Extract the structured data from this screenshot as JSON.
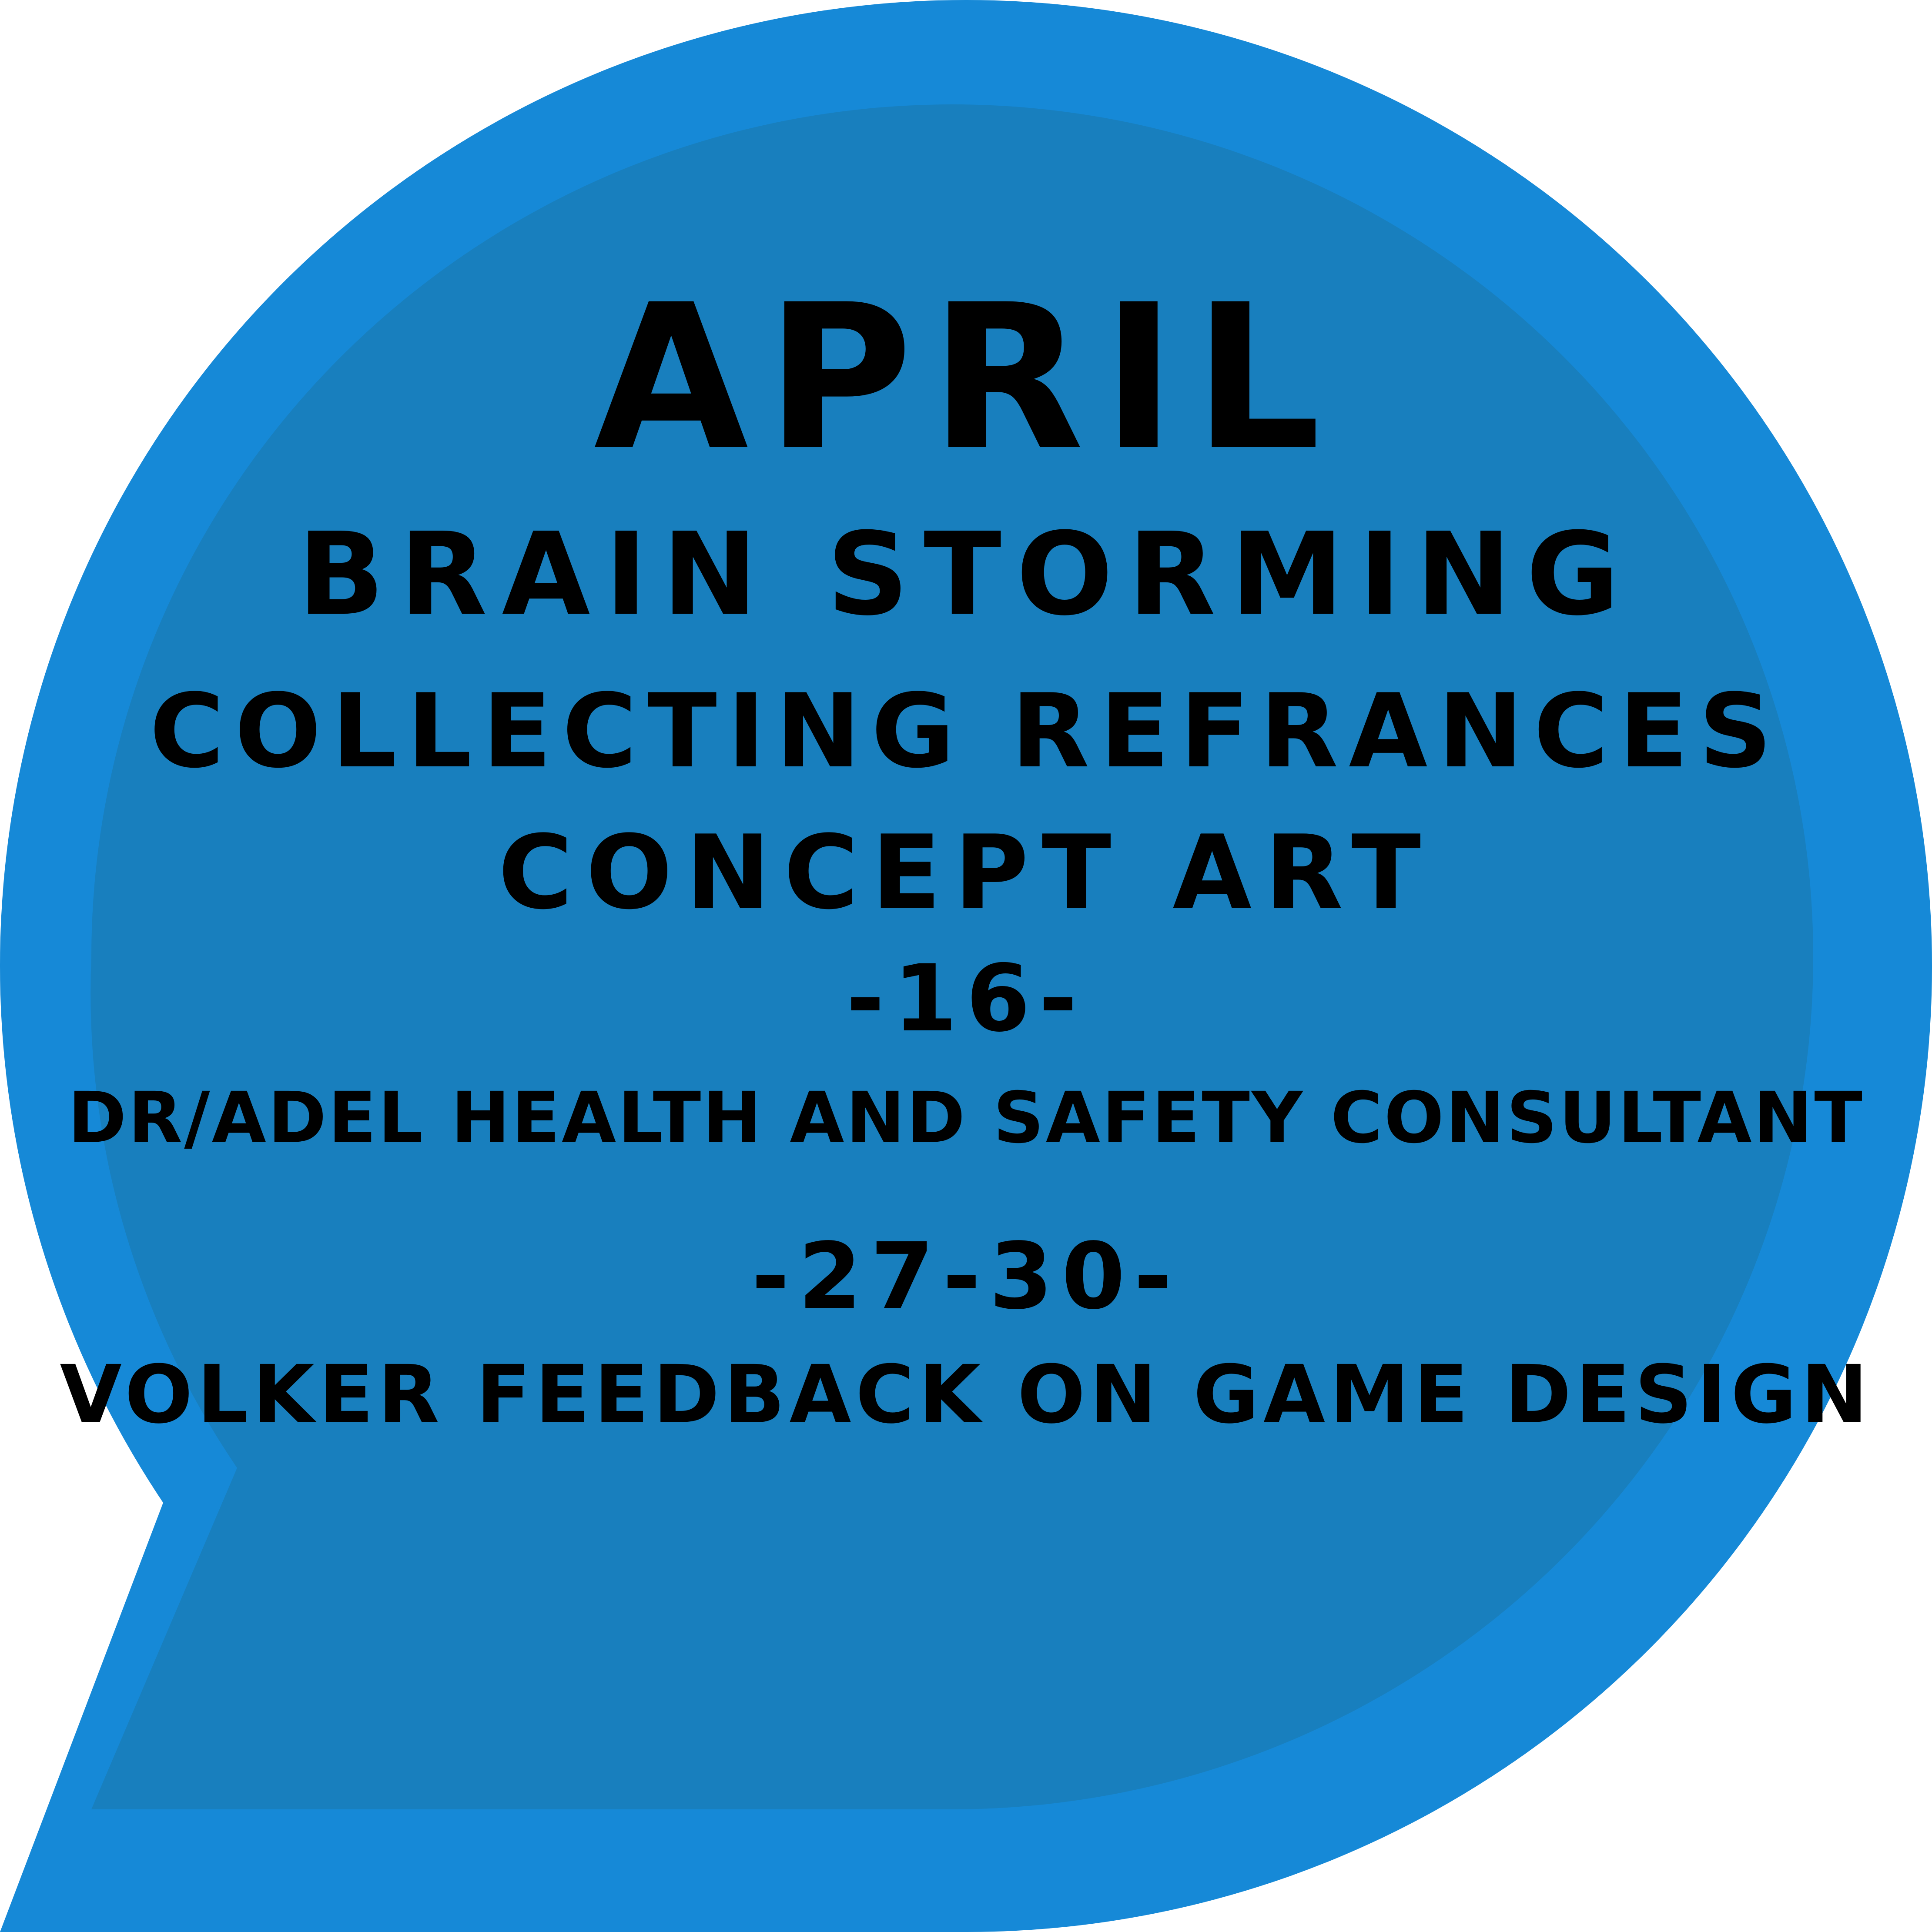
{
  "colors": {
    "outer": "#1689d7",
    "inner": "#187fbe",
    "text": "#000000"
  },
  "bubble": {
    "month": "APRIL",
    "lines": [
      "BRAIN STORMING",
      "COLLECTING REFRANCES",
      "CONCEPT ART",
      "-16-",
      "DR/ADEL HEALTH AND SAFETY CONSULTANT",
      "-27-30-",
      "VOLKER FEEDBACK ON GAME DESIGN"
    ]
  }
}
